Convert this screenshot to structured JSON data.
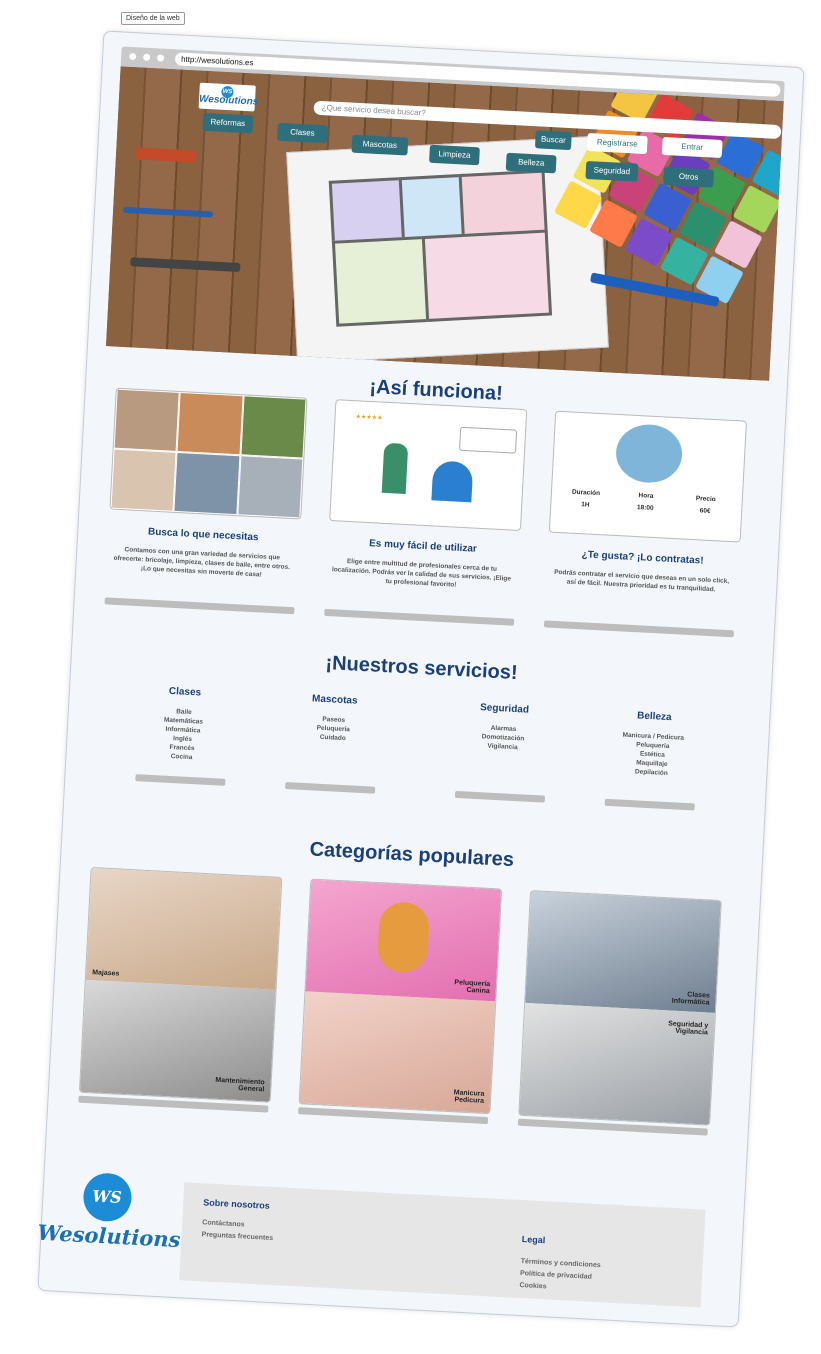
{
  "frame_label": "Diseño de la web",
  "browser": {
    "url": "http://wesolutions.es"
  },
  "header": {
    "logo_initials": "WS",
    "logo_text": "Wesolutions",
    "search_placeholder": "¿Que servicio desea buscar?",
    "search_button": "Buscar",
    "register_button": "Registrarse",
    "login_button": "Entrar",
    "categories": [
      "Reformas",
      "Clases",
      "Mascotas",
      "Limpieza",
      "Belleza",
      "Seguridad",
      "Otros"
    ]
  },
  "how_it_works": {
    "title": "¡Así funciona!",
    "steps": [
      {
        "title": "Busca lo que necesitas",
        "desc": "Contamos con una gran variedad de servicios que ofrecerte: bricolaje, limpieza, clases de baile, entre otros. ¡Lo que necesitas sin moverte de casa!"
      },
      {
        "title": "Es muy fácil de utilizar",
        "desc": "Elige entre multitud de profesionales cerca de tu localización. Podrás ver la calidad de sus servicios. ¡Elige tu profesional favorito!"
      },
      {
        "title": "¿Te gusta? ¡Lo contratas!",
        "desc": "Podrás contratar el servicio que deseas en un solo click, así de fácil. Nuestra prioridad es tu tranquilidad."
      }
    ],
    "booking": {
      "duration_label": "Duración",
      "duration_value": "1H",
      "time_label": "Hora",
      "time_value": "18:00",
      "price_label": "Precio",
      "price_value": "60€"
    },
    "rating_stars": "★★★★★"
  },
  "services": {
    "title": "¡Nuestros servicios!",
    "groups": [
      {
        "title": "Clases",
        "items": [
          "Baile",
          "Matemáticas",
          "Informática",
          "Inglés",
          "Francés",
          "Cocina"
        ]
      },
      {
        "title": "Mascotas",
        "items": [
          "Paseos",
          "Peluquería",
          "Cuidado"
        ]
      },
      {
        "title": "Seguridad",
        "items": [
          "Alarmas",
          "Domotización",
          "Vigilancia"
        ]
      },
      {
        "title": "Belleza",
        "items": [
          "Manicura / Pedicura",
          "Peluquería",
          "Estética",
          "Maquillaje",
          "Depilación"
        ]
      }
    ]
  },
  "popular": {
    "title": "Categorías populares",
    "cards": [
      {
        "top": "Majases",
        "bottom": "Mantenimiento General"
      },
      {
        "top": "Peluquería Canina",
        "bottom": "Manicura Pedicura"
      },
      {
        "top": "Clases Informática",
        "bottom": "Seguridad y Vigilancia"
      }
    ]
  },
  "footer": {
    "logo_initials": "WS",
    "logo_text": "Wesolutions",
    "about_title": "Sobre nosotros",
    "about_links": [
      "Contáctanos",
      "Preguntas frecuentes"
    ],
    "legal_title": "Legal",
    "legal_links": [
      "Términos y condiciones",
      "Política de privacidad",
      "Cookies"
    ]
  },
  "colors": {
    "brand": "#1d8bd6",
    "heading": "#1b3f7a",
    "button": "#2f6f7c"
  }
}
